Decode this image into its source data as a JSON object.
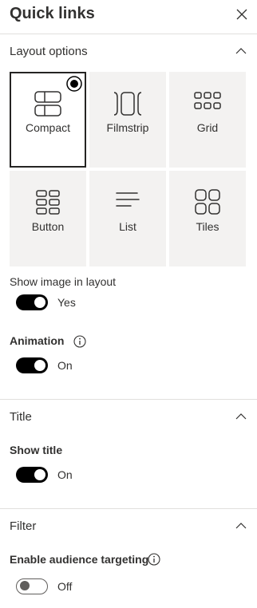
{
  "panel": {
    "title": "Quick links",
    "close_icon": "close-icon"
  },
  "sections": {
    "layout": {
      "label": "Layout options",
      "expanded": true
    },
    "title": {
      "label": "Title",
      "expanded": true
    },
    "filter": {
      "label": "Filter",
      "expanded": true
    }
  },
  "layouts": [
    {
      "label": "Compact",
      "icon": "compact-layout-icon",
      "selected": true
    },
    {
      "label": "Filmstrip",
      "icon": "filmstrip-layout-icon",
      "selected": false
    },
    {
      "label": "Grid",
      "icon": "grid-layout-icon",
      "selected": false
    },
    {
      "label": "Button",
      "icon": "button-layout-icon",
      "selected": false
    },
    {
      "label": "List",
      "icon": "list-layout-icon",
      "selected": false
    },
    {
      "label": "Tiles",
      "icon": "tiles-layout-icon",
      "selected": false
    }
  ],
  "settings": {
    "show_image": {
      "label": "Show image in layout",
      "state_text": "Yes",
      "on": true
    },
    "animation": {
      "label": "Animation",
      "state_text": "On",
      "on": true,
      "info_icon": "info-icon"
    },
    "show_title": {
      "label": "Show title",
      "state_text": "On",
      "on": true
    },
    "audience_targeting": {
      "label": "Enable audience targeting",
      "state_text": "Off",
      "on": false,
      "info_icon": "info-icon"
    }
  },
  "colors": {
    "toggle_on": "#000000",
    "tile_bg": "#f3f2f1",
    "divider": "#e1dfdd",
    "text": "#323130"
  }
}
